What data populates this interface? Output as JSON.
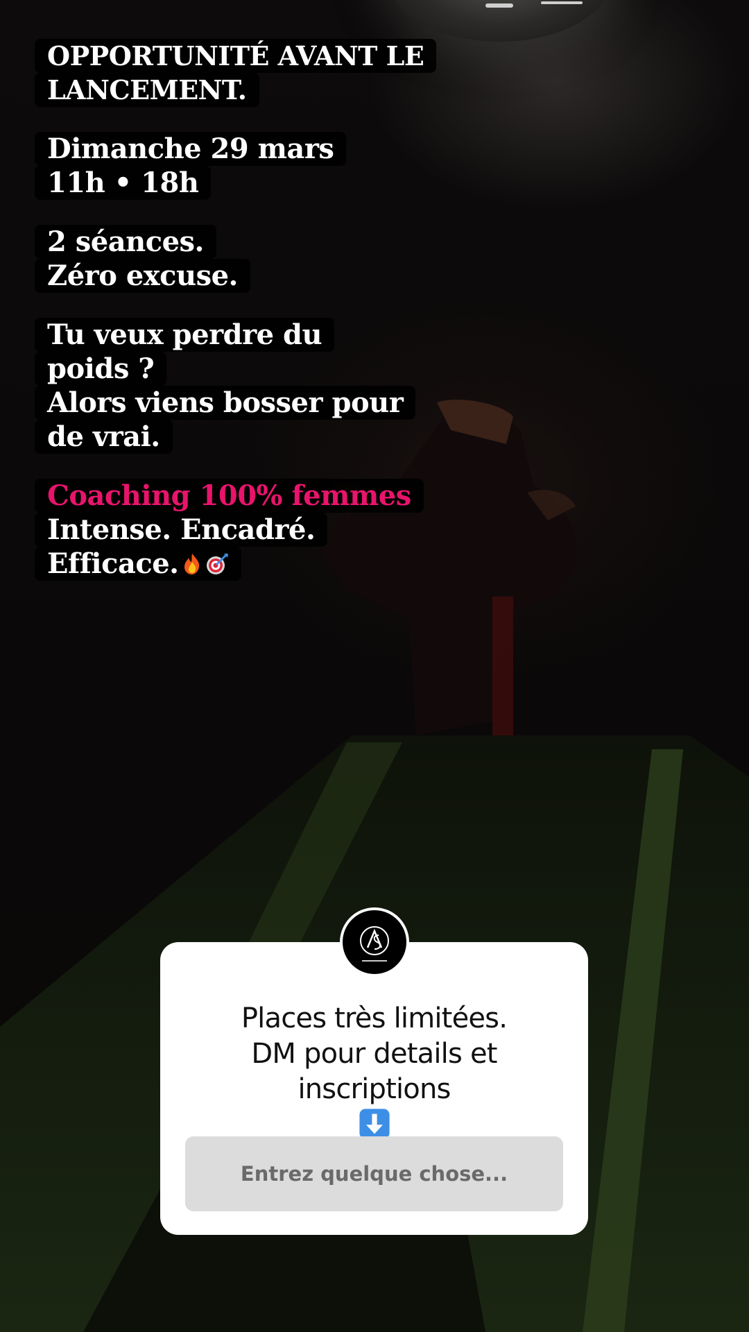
{
  "story_text": {
    "block1": [
      "OPPORTUNITÉ AVANT LE",
      "LANCEMENT."
    ],
    "block2": [
      "Dimanche 29 mars",
      "11h • 18h"
    ],
    "block3": [
      "2 séances.",
      "Zéro excuse."
    ],
    "block4": [
      "Tu veux perdre du",
      "poids ?",
      "Alors viens bosser pour",
      "de vrai."
    ],
    "block5": [
      "Coaching 100% femmes",
      "Intense. Encadré.",
      "Efficace."
    ]
  },
  "question_sticker": {
    "avatar_icon": "brand-logo-icon",
    "question_lines": [
      "Places très limitées.",
      "DM pour details et",
      "inscriptions"
    ],
    "question_emoji": "arrow-down-icon",
    "answer_placeholder": "Entrez quelque chose..."
  },
  "icons": {
    "emoji_1": "fire-icon",
    "emoji_2": "target-icon"
  },
  "colors": {
    "highlight_text": "#e8146c",
    "text_background": "#000000",
    "sticker_background": "#ffffff",
    "answer_field": "#dcdcdc",
    "arrow_emoji": "#3d8fe6"
  }
}
